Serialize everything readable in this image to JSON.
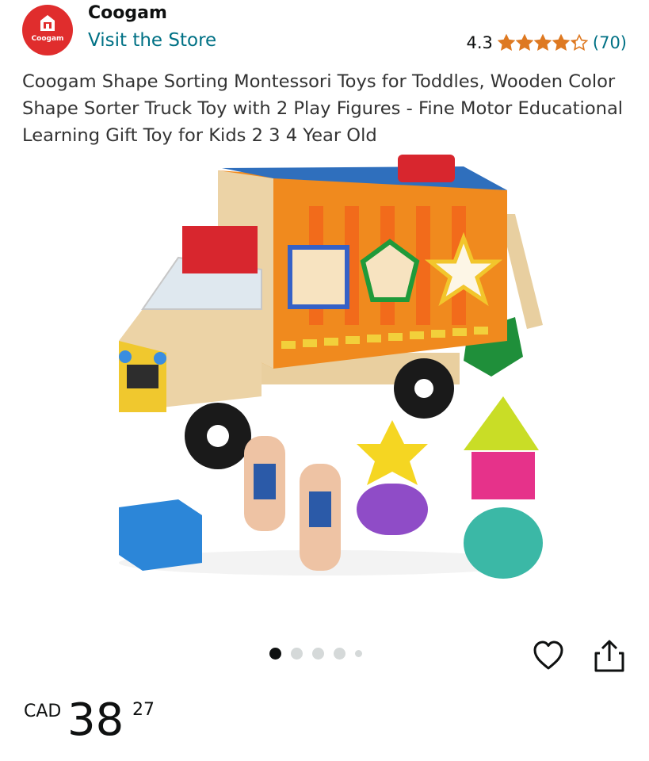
{
  "brand": {
    "logo_text": "Coogam",
    "name": "Coogam",
    "visit_store": "Visit the Store"
  },
  "rating": {
    "value": "4.3",
    "stars": 4.3,
    "count": "(70)"
  },
  "product": {
    "title": "Coogam Shape Sorting Montessori Toys for Toddles, Wooden Color Shape Sorter Truck Toy with 2 Play Figures - Fine Motor Educational Learning Gift Toy for Kids 2 3 4 Year Old",
    "image_icon": "product-photo"
  },
  "carousel": {
    "total": 5,
    "active_index": 0
  },
  "actions": {
    "wishlist_icon": "heart-icon",
    "share_icon": "share-icon"
  },
  "price": {
    "currency": "CAD",
    "whole": "38",
    "fraction": "27"
  },
  "colors": {
    "link": "#007185",
    "star": "#de7921",
    "brand_red": "#e02d2d"
  }
}
